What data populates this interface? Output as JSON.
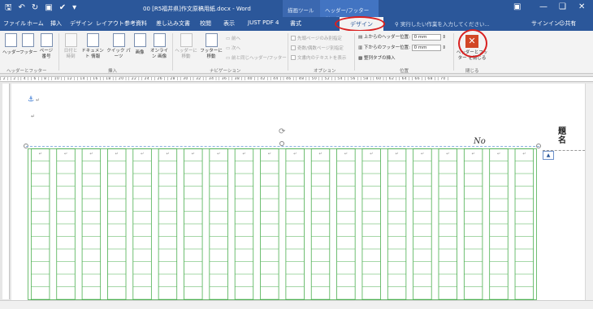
{
  "window": {
    "title": "00 [R5福井県]作文原稿用紙.docx - Word",
    "context_group_drawing": "描画ツール",
    "context_group_header_footer": "ヘッダー/フッター ツール",
    "qat_icons": [
      "save-icon",
      "undo-icon",
      "redo-icon",
      "print-preview-icon",
      "spelling-icon",
      "customize-qat-icon"
    ],
    "controls": [
      "ribbon-display-icon",
      "minimize-icon",
      "restore-icon",
      "close-icon"
    ]
  },
  "tabs": {
    "file": "ファイル",
    "home": "ホーム",
    "insert": "挿入",
    "design_main": "デザイン",
    "layout": "レイアウト",
    "references": "参考資料",
    "mailings": "差し込み文書",
    "review": "校閲",
    "view": "表示",
    "justpdf": "JUST PDF 4",
    "format": "書式",
    "design_active": "デザイン",
    "tell_me": "実行したい作業を入力してください...",
    "signin": "サインイン",
    "share": "共有"
  },
  "ribbon": {
    "header": "ヘッダー",
    "footer": "フッター",
    "page_number": "ページ 番号",
    "group_header_footer": "ヘッダーとフッター",
    "date_time": "日付と 時刻",
    "doc_info": "ドキュメント 情報",
    "quick_parts": "クイック パーツ",
    "pictures": "画像",
    "online_pictures": "オンライン 画像",
    "group_insert": "挿入",
    "goto_header": "ヘッダーに 移動",
    "goto_footer": "フッターに 移動",
    "previous": "前へ",
    "next": "次へ",
    "link_previous": "前と同じヘッダー/フッター",
    "group_navigation": "ナビゲーション",
    "different_first": "先頭ページのみ別指定",
    "different_odd_even": "奇数/偶数ページ別指定",
    "show_doc_text": "文書内のテキストを表示",
    "group_options": "オプション",
    "header_from_top": "上からのヘッダー位置:",
    "header_from_top_value": "0 mm",
    "footer_from_bottom": "下からのフッター位置:",
    "footer_from_bottom_value": "0 mm",
    "insert_alignment_tab": "整列タブの挿入",
    "group_position": "位置",
    "close_header_footer": "ヘッダーとフッター を閉じる",
    "group_close": "閉じる"
  },
  "ruler": {
    "marks": "| 2 |   | 2 |  | 4 |  | 6 |  | 8 |  | 10 |  | 12 |  | 14 |  | 16 |  | 18 |  | 20 |  | 22 |  | 24 |  | 26 |  | 28 |  | 30 |  | 32 |  | 34 |  | 36 |  | 38 |  | 40 |  | 42 |  | 44 |  | 46 |  | 48 |  | 50 |  | 52 |  | 54 |  | 56 |  | 58 |  | 60 |  | 62 |  | 64 |  | 66 |  | 68 |  | 70 |"
  },
  "document": {
    "no_label": "No",
    "side_title": "題名",
    "grid_columns": 20,
    "grid_color": "#4caf50",
    "accent": "#2b579a",
    "highlight": "#d82020"
  }
}
